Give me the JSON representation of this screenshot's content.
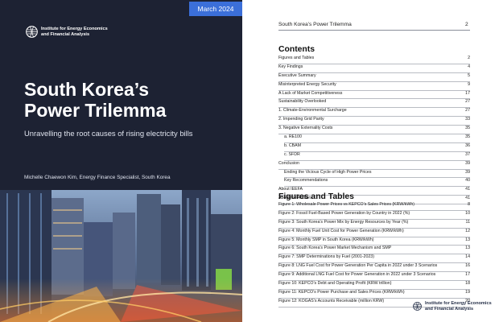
{
  "cover": {
    "date": "March 2024",
    "org_line1": "Institute for Energy Economics",
    "org_line2": "and Financial Analysis",
    "title_line1": "South Korea’s",
    "title_line2": "Power Trilemma",
    "subtitle": "Unravelling the root causes of rising electricity bills",
    "author": "Michelle Chaewon Kim, Energy Finance Specialist, South Korea"
  },
  "toc_page": {
    "running_title": "South Korea’s Power Trilemma",
    "page_number": "2",
    "contents_heading": "Contents",
    "contents": [
      {
        "label": "Figures and Tables",
        "page": "2",
        "indent": false
      },
      {
        "label": "Key Findings",
        "page": "4",
        "indent": false
      },
      {
        "label": "Executive Summary",
        "page": "5",
        "indent": false
      },
      {
        "label": "Misinterpreted Energy Security",
        "page": "9",
        "indent": false
      },
      {
        "label": "A Lack of Market Competitiveness",
        "page": "17",
        "indent": false
      },
      {
        "label": "Sustainability Overlooked",
        "page": "27",
        "indent": false
      },
      {
        "label": "1. Climate-Environmental Surcharge",
        "page": "27",
        "indent": false
      },
      {
        "label": "2. Impending Grid Parity",
        "page": "33",
        "indent": false
      },
      {
        "label": "3. Negative Externality Costs",
        "page": "35",
        "indent": false
      },
      {
        "label": "a. RE100",
        "page": "35",
        "indent": true
      },
      {
        "label": "b. CBAM",
        "page": "36",
        "indent": true
      },
      {
        "label": "c. SFDR",
        "page": "37",
        "indent": true
      },
      {
        "label": "Conclusion",
        "page": "39",
        "indent": false
      },
      {
        "label": "Ending the Vicious Cycle of High Power Prices",
        "page": "39",
        "indent": true
      },
      {
        "label": "Key Recommendations",
        "page": "40",
        "indent": true
      },
      {
        "label": "About IEEFA",
        "page": "41",
        "indent": false
      },
      {
        "label": "About the Authors",
        "page": "41",
        "indent": false
      }
    ],
    "figures_heading": "Figures and Tables",
    "figures": [
      {
        "label": "Figure 1: Wholesale Power Prices vs KEPCO’s Sales Prices (KRW/kWh)",
        "page": "8"
      },
      {
        "label": "Figure 2: Fossil Fuel-Based Power Generation by Country in 2022 (%)",
        "page": "10"
      },
      {
        "label": "Figure 3: South Korea’s Power Mix by Energy Resources by Year (%)",
        "page": "11"
      },
      {
        "label": "Figure 4: Monthly Fuel Unit Cost for Power Generation (KRW/kWh)",
        "page": "12"
      },
      {
        "label": "Figure 5: Monthly SMP in South Korea (KRW/kWh)",
        "page": "13"
      },
      {
        "label": "Figure 6: South Korea’s Power Market Mechanism and SMP",
        "page": "13"
      },
      {
        "label": "Figure 7: SMP Determinations by Fuel (2001-2023)",
        "page": "14"
      },
      {
        "label": "Figure 8: LNG Fuel Cost for Power Generation Per Capita in 2022 under 3 Scenarios",
        "page": "16"
      },
      {
        "label": "Figure 9: Additional LNG Fuel Cost for Power Generation in 2022 under 3 Scenarios",
        "page": "17"
      },
      {
        "label": "Figure 10: KEPCO’s Debt and Operating Profit (KRW trillion)",
        "page": "18"
      },
      {
        "label": "Figure 11: KEPCO’s Power Purchase and Sales Prices (KRW/kWh)",
        "page": "19"
      },
      {
        "label": "Figure 12: KOGAS’s Accounts Receivable (million KRW)",
        "page": "20"
      }
    ],
    "org_line1": "Institute for Energy Economics",
    "org_line2": "and Financial Analysis"
  },
  "colors": {
    "cover_background": "#1d2233",
    "date_badge": "#3b6fd9",
    "page_background": "#ffffff",
    "leader_rule": "#b9bcc3"
  },
  "icons": [
    "globe-logo-icon"
  ]
}
